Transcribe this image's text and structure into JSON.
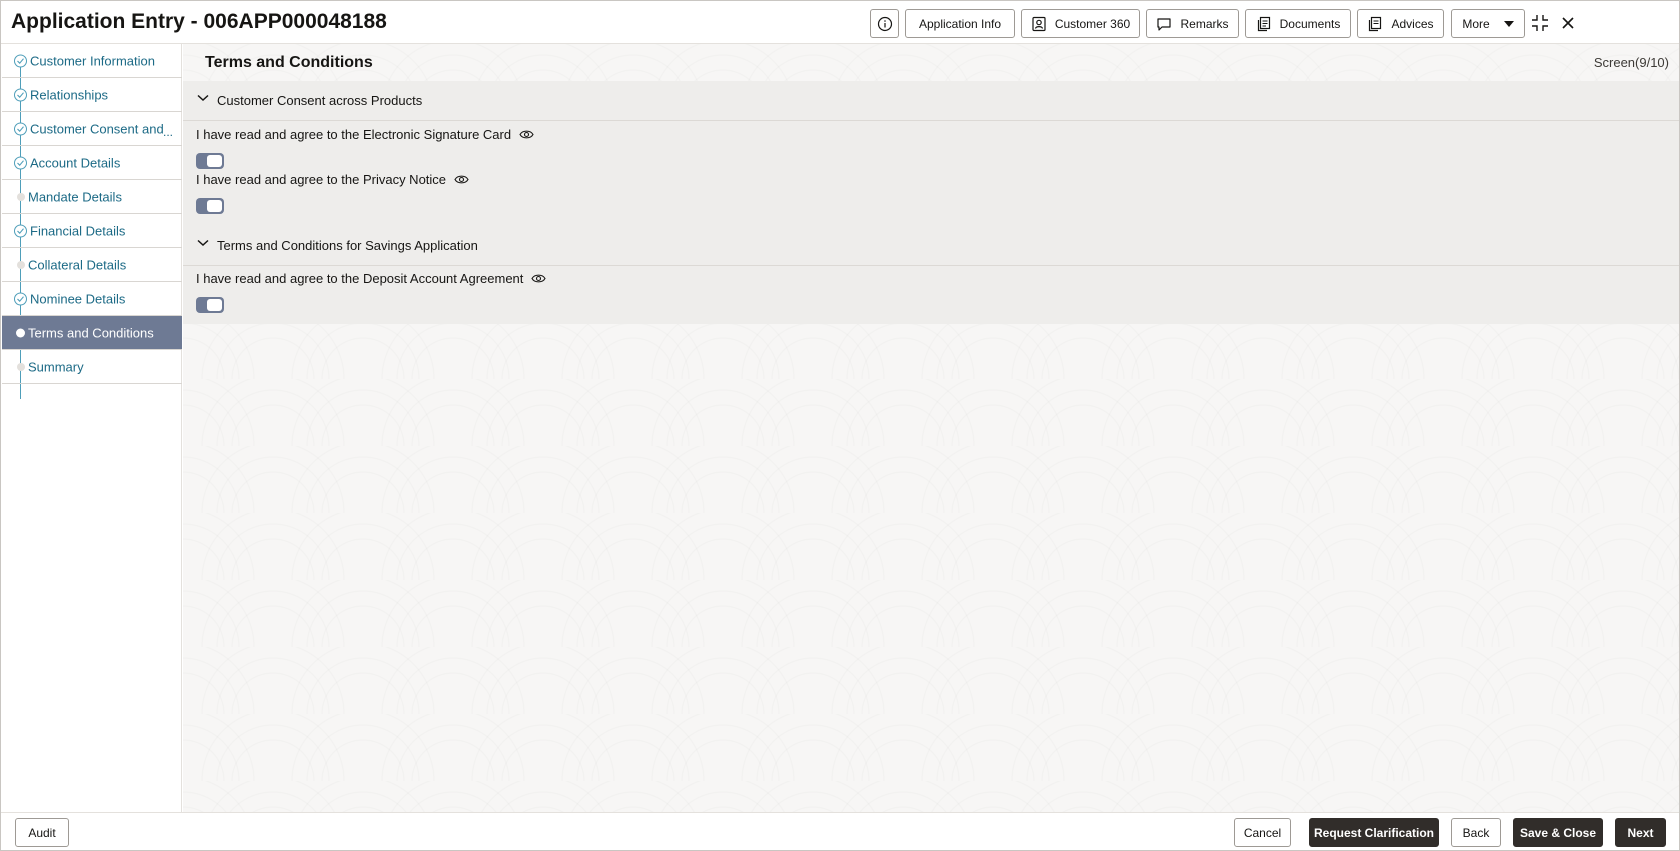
{
  "header": {
    "title": "Application Entry - 006APP000048188",
    "buttons": {
      "application_info": "Application Info",
      "customer_360": "Customer 360",
      "remarks": "Remarks",
      "documents": "Documents",
      "advices": "Advices",
      "more": "More"
    },
    "icons": [
      "info-icon",
      "customer-card-icon",
      "comment-icon",
      "documents-icon",
      "advices-icon",
      "caret-down-icon",
      "minimize-icon",
      "close-icon"
    ]
  },
  "sidebar": {
    "steps": [
      {
        "label": "Customer Information",
        "state": "complete"
      },
      {
        "label": "Relationships",
        "state": "complete"
      },
      {
        "label": "Customer Consent and",
        "state": "complete",
        "truncated": "..."
      },
      {
        "label": "Account Details",
        "state": "complete"
      },
      {
        "label": "Mandate Details",
        "state": "pending"
      },
      {
        "label": "Financial Details",
        "state": "complete"
      },
      {
        "label": "Collateral Details",
        "state": "pending"
      },
      {
        "label": "Nominee Details",
        "state": "complete"
      },
      {
        "label": "Terms and Conditions",
        "state": "active"
      },
      {
        "label": "Summary",
        "state": "pending"
      }
    ]
  },
  "main": {
    "title": "Terms and Conditions",
    "screen_indicator": "Screen(9/10)",
    "sections": [
      {
        "title": "Customer Consent across Products",
        "expanded": true,
        "items": [
          {
            "label": "I have read and agree to the Electronic Signature Card",
            "checked": true
          },
          {
            "label": "I have read and agree to the Privacy Notice",
            "checked": true
          }
        ]
      },
      {
        "title": "Terms and Conditions for Savings Application",
        "expanded": true,
        "items": [
          {
            "label": "I have read and agree to the Deposit Account Agreement",
            "checked": true
          }
        ]
      }
    ]
  },
  "footer": {
    "audit": "Audit",
    "cancel": "Cancel",
    "request_clarification": "Request Clarification",
    "back": "Back",
    "save_close": "Save & Close",
    "next": "Next"
  },
  "colors": {
    "accent": "#4e9eb9",
    "link_text": "#1c6a86",
    "active_step": "#6e7a94",
    "toggle_on": "#6e7a94",
    "primary_button": "#312d2a"
  }
}
